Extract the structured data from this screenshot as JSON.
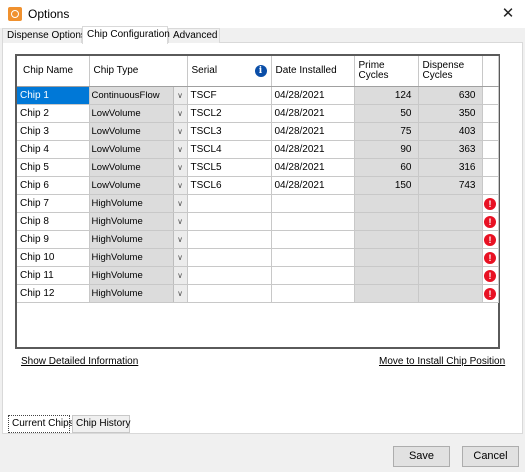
{
  "window": {
    "title": "Options"
  },
  "top_tabs": [
    "Dispense Options",
    "Chip Configuration",
    "Advanced"
  ],
  "table": {
    "headers": [
      "Chip Name",
      "Chip Type",
      "Serial",
      "Date Installed",
      "Prime Cycles",
      "Dispense Cycles"
    ],
    "rows": [
      {
        "name": "Chip 1",
        "type": "ContinuousFlow",
        "serial": "TSCF",
        "date": "04/28/2021",
        "prime": "124",
        "dispense": "630",
        "warning": false
      },
      {
        "name": "Chip 2",
        "type": "LowVolume",
        "serial": "TSCL2",
        "date": "04/28/2021",
        "prime": "50",
        "dispense": "350",
        "warning": false
      },
      {
        "name": "Chip 3",
        "type": "LowVolume",
        "serial": "TSCL3",
        "date": "04/28/2021",
        "prime": "75",
        "dispense": "403",
        "warning": false
      },
      {
        "name": "Chip 4",
        "type": "LowVolume",
        "serial": "TSCL4",
        "date": "04/28/2021",
        "prime": "90",
        "dispense": "363",
        "warning": false
      },
      {
        "name": "Chip 5",
        "type": "LowVolume",
        "serial": "TSCL5",
        "date": "04/28/2021",
        "prime": "60",
        "dispense": "316",
        "warning": false
      },
      {
        "name": "Chip 6",
        "type": "LowVolume",
        "serial": "TSCL6",
        "date": "04/28/2021",
        "prime": "150",
        "dispense": "743",
        "warning": false
      },
      {
        "name": "Chip 7",
        "type": "HighVolume",
        "serial": "",
        "date": "",
        "prime": "",
        "dispense": "",
        "warning": true
      },
      {
        "name": "Chip 8",
        "type": "HighVolume",
        "serial": "",
        "date": "",
        "prime": "",
        "dispense": "",
        "warning": true
      },
      {
        "name": "Chip 9",
        "type": "HighVolume",
        "serial": "",
        "date": "",
        "prime": "",
        "dispense": "",
        "warning": true
      },
      {
        "name": "Chip 10",
        "type": "HighVolume",
        "serial": "",
        "date": "",
        "prime": "",
        "dispense": "",
        "warning": true
      },
      {
        "name": "Chip 11",
        "type": "HighVolume",
        "serial": "",
        "date": "",
        "prime": "",
        "dispense": "",
        "warning": true
      },
      {
        "name": "Chip 12",
        "type": "HighVolume",
        "serial": "",
        "date": "",
        "prime": "",
        "dispense": "",
        "warning": true
      }
    ]
  },
  "links": {
    "details": "Show Detailed Information",
    "install": "Move to Install Chip Position"
  },
  "sub_tabs": [
    "Current Chips",
    "Chip History"
  ],
  "buttons": {
    "save": "Save",
    "cancel": "Cancel"
  },
  "colors": {
    "selection": "#0078d7",
    "warning": "#e81123",
    "info": "#0a4ea8",
    "app_icon": "#f0912e"
  }
}
